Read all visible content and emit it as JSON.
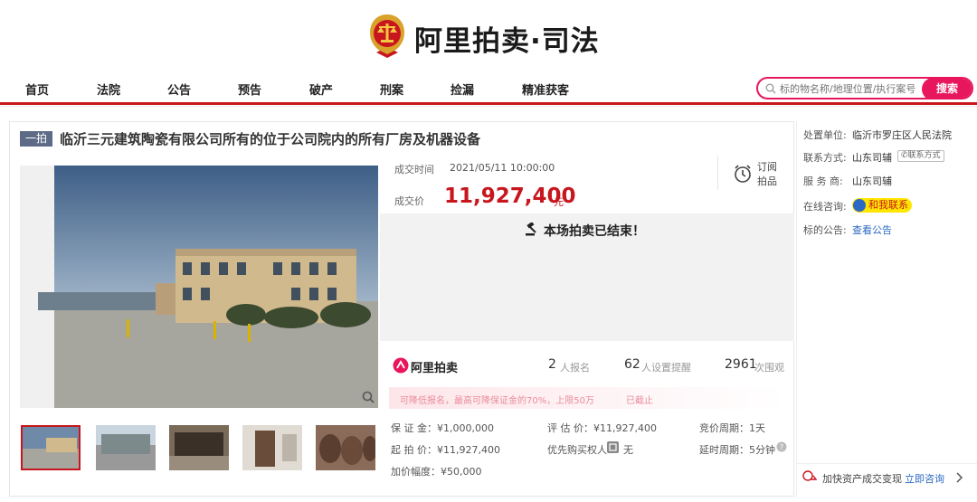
{
  "brand": {
    "name": "阿里拍卖·司法"
  },
  "nav": {
    "items": [
      "首页",
      "法院",
      "公告",
      "预告",
      "破产",
      "刑案",
      "捡漏",
      "精准获客"
    ]
  },
  "search": {
    "placeholder": "标的物名称/地理位置/执行案号",
    "button": "搜索"
  },
  "lot": {
    "badge": "一拍",
    "title": "临沂三元建筑陶瓷有限公司所有的位于公司院内的所有厂房及机器设备",
    "deal_time_label": "成交时间",
    "deal_time": "2021/05/11 10:00:00",
    "deal_price_label": "成交价",
    "deal_price": "11,927,400",
    "deal_price_unit": "元",
    "ended_text": "本场拍卖已结束！",
    "subscribe": [
      "订阅",
      "拍品"
    ]
  },
  "stats": {
    "logo": "阿里拍卖",
    "signups": "2",
    "signups_label": "人报名",
    "reminders": "62",
    "reminders_label": "人设置提醒",
    "views": "2961",
    "views_label": "次围观"
  },
  "notice": {
    "text": "可降低报名，最高可降保证金的70%，上限50万",
    "status": "已截止"
  },
  "details": {
    "deposit": "保 证 金：¥1,000,000",
    "start_price": "起 拍 价：¥11,927,400",
    "increment": "加价幅度：¥50,000",
    "appraisal": "评 估 价：¥11,927,400",
    "priority": "优先购买权人",
    "priority_val": "无",
    "period": "竞价周期：1天",
    "delay": "延时周期：5分钟"
  },
  "sidebar": {
    "court_label": "处置单位:",
    "court": "临沂市罗庄区人民法院",
    "contact_label": "联系方式:",
    "contact": "山东司辅",
    "contact_btn": "联系方式",
    "service_label": "服 务 商:",
    "service": "山东司辅",
    "consult_label": "在线咨询:",
    "consult": "和我联系",
    "notice_label": "标的公告:",
    "notice_link": "查看公告",
    "promo": "加快资产成交变现",
    "promo_link": "立即咨询"
  },
  "colors": {
    "accent": "#c8161e",
    "pink": "#e8175d",
    "link": "#2a68c3"
  }
}
